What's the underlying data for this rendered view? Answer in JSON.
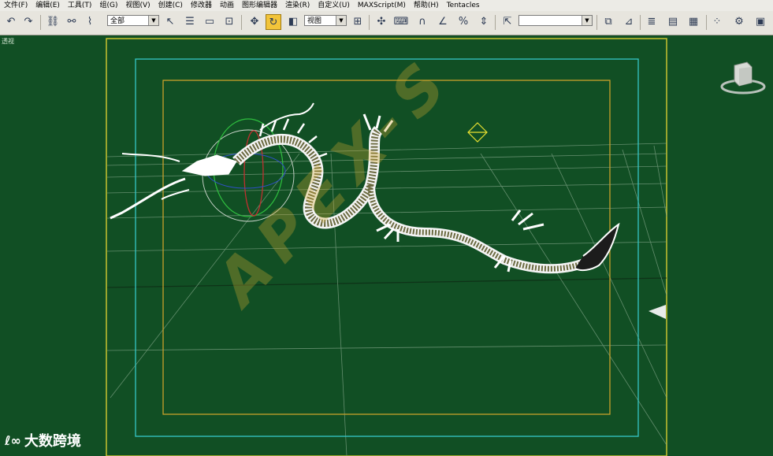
{
  "menu": [
    "文件(F)",
    "编辑(E)",
    "工具(T)",
    "组(G)",
    "视图(V)",
    "创建(C)",
    "修改器",
    "动画",
    "图形编辑器",
    "渲染(R)",
    "自定义(U)",
    "MAXScript(M)",
    "帮助(H)",
    "Tentacles"
  ],
  "toolbar": {
    "selection_filter": "全部",
    "coord_system": "视图",
    "named_selection": ""
  },
  "viewport": {
    "label": "透视",
    "background": "#114f24"
  },
  "watermark": "APEX-S",
  "logo": {
    "text": "大数跨境"
  },
  "colors": {
    "safe_frame_outer": "#35c7c7",
    "safe_frame_inner": "#c9a02a",
    "active_border": "#c9c430"
  }
}
